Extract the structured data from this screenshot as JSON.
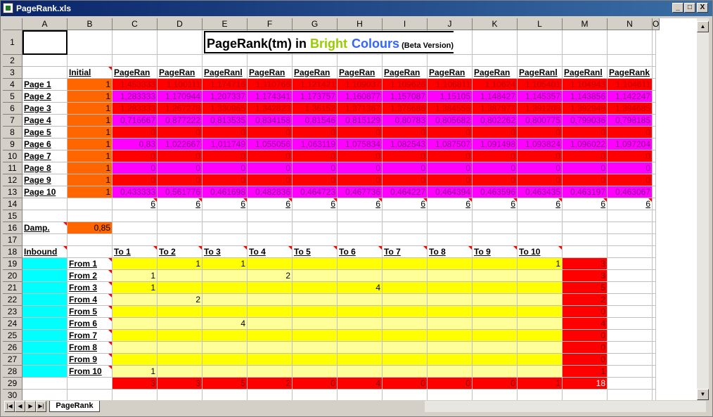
{
  "window": {
    "title": "PageRank.xls",
    "min": "_",
    "max": "□",
    "close": "X"
  },
  "sheet": {
    "title_a": "PageRank(tm) in ",
    "title_b": "Bright",
    "title_c": "Colours",
    "title_d": " (Beta Version)",
    "title_b_color": "#99cc00",
    "title_c_color": "#3366ff",
    "initial_label": "Initial",
    "damp_label": "Damp.",
    "damp_value": "0,85",
    "inbound_label": "Inbound",
    "col_headers": [
      "A",
      "B",
      "C",
      "D",
      "E",
      "F",
      "G",
      "H",
      "I",
      "J",
      "K",
      "L",
      "M",
      "N",
      "O"
    ],
    "row_headers": [
      "1",
      "2",
      "3",
      "4",
      "5",
      "6",
      "7",
      "8",
      "9",
      "10",
      "11",
      "12",
      "13",
      "14",
      "15",
      "16",
      "17",
      "18",
      "19",
      "20",
      "21",
      "22",
      "23",
      "24",
      "25",
      "26",
      "27",
      "28",
      "29",
      "30"
    ],
    "pr_header": [
      "PageRan",
      "PageRan",
      "PageRanl",
      "PageRan",
      "PageRan",
      "PageRan",
      "PageRan",
      "PageRan",
      "PageRan",
      "PageRanl",
      "PageRanl",
      "PageRank"
    ],
    "pages": [
      {
        "label": "Page 1",
        "init": "1",
        "vals": [
          "1,453333",
          "1,100111",
          "1,174716",
          "1,110766",
          "1,121421",
          "1,109037",
          "1,109626",
          "1,106811",
          "1,10624",
          "1,105401",
          "1,104943",
          "1,104611"
        ]
      },
      {
        "label": "Page 2",
        "init": "1",
        "vals": [
          "1,283333",
          "1,170944",
          "1,207337",
          "1,174341",
          "1,173757",
          "1,160877",
          "1,157087",
          "1,15105",
          "1,148427",
          "1,145357",
          "1,143856",
          "1,142247"
        ]
      },
      {
        "label": "Page 3",
        "init": "1",
        "vals": [
          "1,283333",
          "1,267278",
          "1,330965",
          "1,342823",
          "1,36152",
          "1,371367",
          "1,378686",
          "1,384556",
          "1,387977",
          "1,391208",
          "1,392948",
          "1,394685"
        ]
      },
      {
        "label": "Page 4",
        "init": "1",
        "vals": [
          "0,716667",
          "0,877222",
          "0,813535",
          "0,834158",
          "0,81546",
          "0,815129",
          "0,80783",
          "0,805682",
          "0,802262",
          "0,800775",
          "0,799036",
          "0,798185"
        ]
      },
      {
        "label": "Page 5",
        "init": "1",
        "vals": [
          "0",
          "0",
          "0",
          "0",
          "0",
          "0",
          "0",
          "0",
          "0",
          "0",
          "0",
          "0"
        ]
      },
      {
        "label": "Page 6",
        "init": "1",
        "vals": [
          "0,83",
          "1,022667",
          "1,011749",
          "1,055056",
          "1,063119",
          "1,075834",
          "1,082543",
          "1,087507",
          "1,091498",
          "1,093824",
          "1,096022",
          "1,097204"
        ]
      },
      {
        "label": "Page 7",
        "init": "1",
        "vals": [
          "0",
          "0",
          "0",
          "0",
          "0",
          "0",
          "0",
          "0",
          "0",
          "0",
          "0",
          "0"
        ]
      },
      {
        "label": "Page 8",
        "init": "1",
        "vals": [
          "0",
          "0",
          "0",
          "0",
          "0",
          "0",
          "0",
          "0",
          "0",
          "0",
          "0",
          "0"
        ]
      },
      {
        "label": "Page 9",
        "init": "1",
        "vals": [
          "0",
          "0",
          "0",
          "0",
          "0",
          "0",
          "0",
          "0",
          "0",
          "0",
          "0",
          "0"
        ]
      },
      {
        "label": "Page 10",
        "init": "1",
        "vals": [
          "0,433333",
          "0,561776",
          "0,461698",
          "0,482836",
          "0,464723",
          "0,467736",
          "0,464227",
          "0,464394",
          "0,463596",
          "0,463435",
          "0,463197",
          "0,463067"
        ]
      }
    ],
    "sum_row": [
      "6",
      "6",
      "6",
      "6",
      "6",
      "6",
      "6",
      "6",
      "6",
      "6",
      "6",
      "6"
    ],
    "to_headers": [
      "To 1",
      "To 2",
      "To 3",
      "To 4",
      "To 5",
      "To 6",
      "To 7",
      "To 8",
      "To 9",
      "To 10"
    ],
    "from": [
      {
        "label": "From 1",
        "cells": [
          "",
          "1",
          "1",
          "",
          "",
          "",
          "",
          "",
          "",
          "1"
        ],
        "total": "3"
      },
      {
        "label": "From 2",
        "cells": [
          "1",
          "",
          "",
          "2",
          "",
          "",
          "",
          "",
          "",
          ""
        ],
        "total": "3"
      },
      {
        "label": "From 3",
        "cells": [
          "1",
          "",
          "",
          "",
          "",
          "4",
          "",
          "",
          "",
          ""
        ],
        "total": "5"
      },
      {
        "label": "From 4",
        "cells": [
          "",
          "2",
          "",
          "",
          "",
          "",
          "",
          "",
          "",
          ""
        ],
        "total": "2"
      },
      {
        "label": "From 5",
        "cells": [
          "",
          "",
          "",
          "",
          "",
          "",
          "",
          "",
          "",
          ""
        ],
        "total": "0"
      },
      {
        "label": "From 6",
        "cells": [
          "",
          "",
          "4",
          "",
          "",
          "",
          "",
          "",
          "",
          ""
        ],
        "total": "4"
      },
      {
        "label": "From 7",
        "cells": [
          "",
          "",
          "",
          "",
          "",
          "",
          "",
          "",
          "",
          ""
        ],
        "total": "0"
      },
      {
        "label": "From 8",
        "cells": [
          "",
          "",
          "",
          "",
          "",
          "",
          "",
          "",
          "",
          ""
        ],
        "total": "0"
      },
      {
        "label": "From 9",
        "cells": [
          "",
          "",
          "",
          "",
          "",
          "",
          "",
          "",
          "",
          ""
        ],
        "total": "0"
      },
      {
        "label": "From 10",
        "cells": [
          "1",
          "",
          "",
          "",
          "",
          "",
          "",
          "",
          "",
          ""
        ],
        "total": "1"
      }
    ],
    "col_totals": [
      "3",
      "3",
      "5",
      "2",
      "0",
      "4",
      "0",
      "0",
      "0",
      "1"
    ],
    "grand_total": "18",
    "tab_name": "PageRank"
  }
}
